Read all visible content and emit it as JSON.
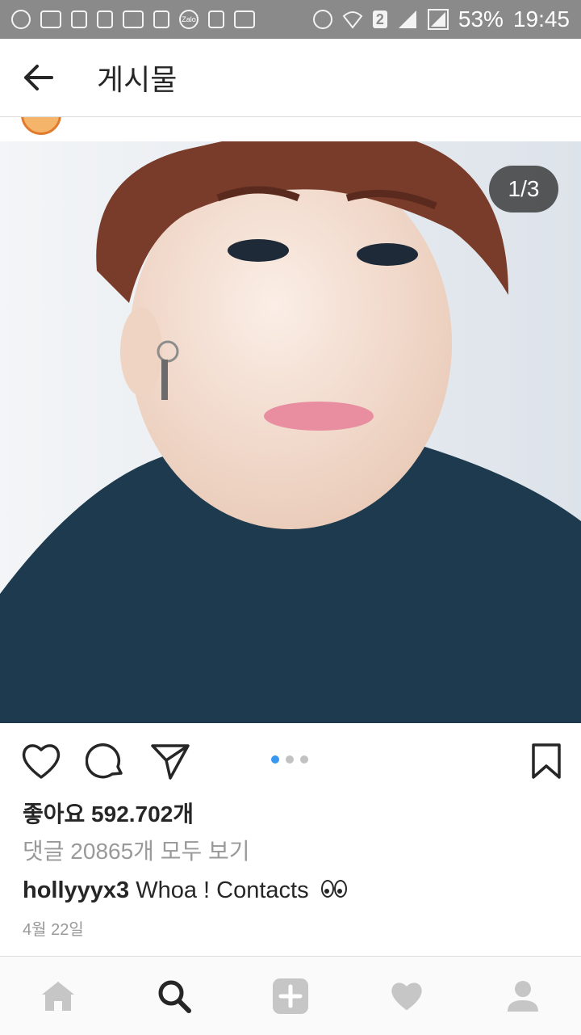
{
  "status_bar": {
    "sim_number": "2",
    "battery": "53%",
    "time": "19:45",
    "left_icons": [
      "messaging-icon",
      "gallery-icon",
      "phone-icon",
      "recycle-icon",
      "mail-icon",
      "facebook-icon",
      "zalo-icon",
      "add-contact-icon",
      "at-icon"
    ],
    "zalo_label": "Zalo"
  },
  "header": {
    "title": "게시물"
  },
  "post": {
    "image_counter": "1/3",
    "carousel_total": 3,
    "carousel_active": 1,
    "likes": "좋아요 592.702개",
    "view_comments": "댓글 20865개 모두 보기",
    "username": "hollyyyx3",
    "caption_text": " Whoa ! Contacts",
    "date": "4월 22일"
  },
  "nav": {
    "items": [
      "home-icon",
      "search-icon",
      "add-post-icon",
      "activity-icon",
      "profile-icon"
    ]
  },
  "colors": {
    "accent": "#3897f0",
    "text": "#262626",
    "muted": "#999999",
    "statusbar": "#8a8a8a"
  }
}
